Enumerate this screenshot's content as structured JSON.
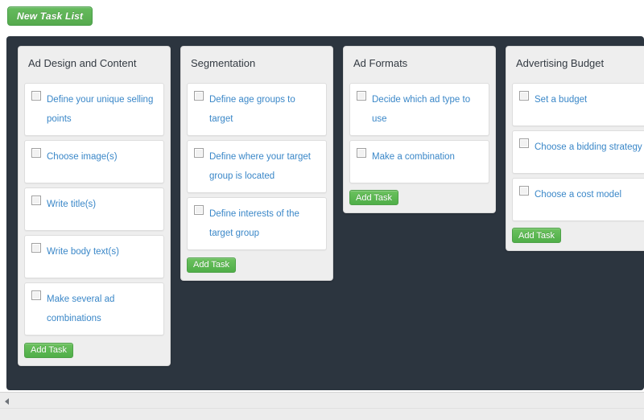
{
  "toolbar": {
    "new_task_list_label": "New Task List"
  },
  "board": {
    "background_color": "#2c353f",
    "add_task_label": "Add Task",
    "columns": [
      {
        "title": "Ad Design and Content",
        "add_task_label": "Add Task",
        "tasks": [
          {
            "label": "Define your unique selling points",
            "checked": false
          },
          {
            "label": "Choose image(s)",
            "checked": false
          },
          {
            "label": "Write title(s)",
            "checked": false
          },
          {
            "label": "Write body text(s)",
            "checked": false
          },
          {
            "label": "Make several ad combinations",
            "checked": false
          }
        ]
      },
      {
        "title": "Segmentation",
        "add_task_label": "Add Task",
        "tasks": [
          {
            "label": "Define age groups to target",
            "checked": false
          },
          {
            "label": "Define where your target group is located",
            "checked": false
          },
          {
            "label": "Define interests of the target group",
            "checked": false
          }
        ]
      },
      {
        "title": "Ad Formats",
        "add_task_label": "Add Task",
        "tasks": [
          {
            "label": "Decide which ad type to use",
            "checked": false
          },
          {
            "label": "Make a combination",
            "checked": false
          }
        ]
      },
      {
        "title": "Advertising Budget",
        "add_task_label": "Add Task",
        "tasks": [
          {
            "label": "Set a budget",
            "checked": false
          },
          {
            "label": "Choose a bidding strategy",
            "checked": false
          },
          {
            "label": "Choose a cost model",
            "checked": false
          }
        ]
      }
    ]
  },
  "scrollbar": {
    "orientation": "horizontal",
    "left_arrow_icon": "triangle-left-icon"
  },
  "colors": {
    "board_background": "#2c353f",
    "panel_background": "#eeeeee",
    "card_background": "#ffffff",
    "task_text": "#3a87c8",
    "button_green": "#55aa4d",
    "header_text": "#333a42"
  }
}
